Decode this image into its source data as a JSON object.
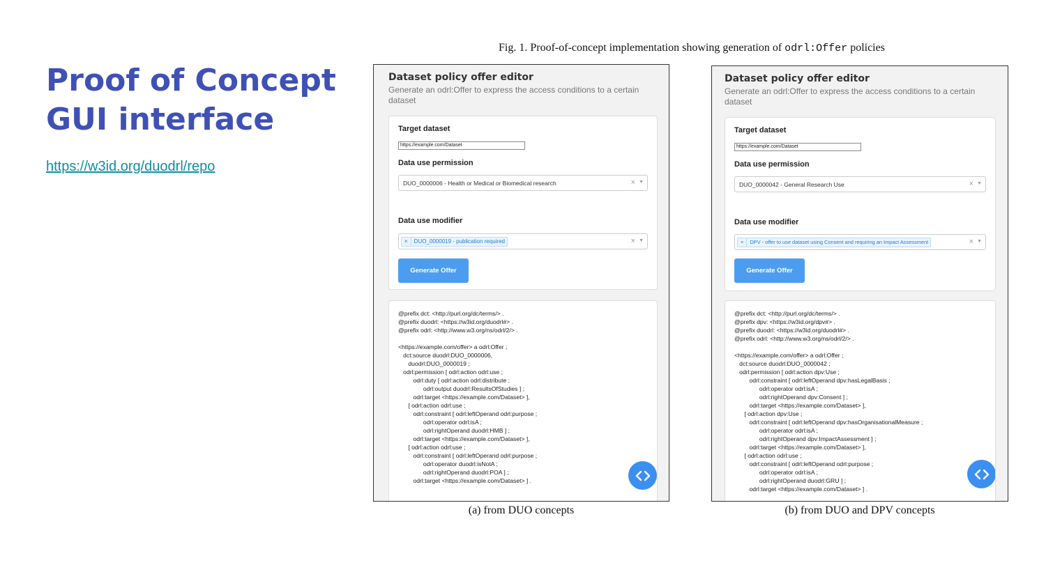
{
  "slide": {
    "title_line1": "Proof of Concept",
    "title_line2": "GUI interface",
    "repo_link": "https://w3id.org/duodrl/repo"
  },
  "figure": {
    "caption_prefix": "Fig. 1. Proof-of-concept implementation showing generation of ",
    "caption_code": "odrl:Offer",
    "caption_suffix": " policies",
    "subcaption_a": "(a)  from DUO concepts",
    "subcaption_b": "(b)  from DUO and DPV concepts"
  },
  "panels": {
    "a": {
      "editor_title": "Dataset policy offer editor",
      "editor_desc": "Generate an odrl:Offer to express the access conditions to a certain dataset",
      "target_label": "Target dataset",
      "target_value": "https://example.com/Dataset",
      "permission_label": "Data use permission",
      "permission_value": "DUO_0000006 - Health or Medical or Biomedical research",
      "modifier_label": "Data use modifier",
      "modifier_tag": "DUO_0000019 - publication required",
      "clear_symbol": "×",
      "tag_remove_symbol": "×",
      "generate_label": "Generate Offer",
      "code_lines": [
        "@prefix dct: <http://purl.org/dc/terms/> .",
        "@prefix duodrl: <https://w3id.org/duodrl#> .",
        "@prefix odrl: <http://www.w3.org/ns/odrl/2/> .",
        "",
        "<https://example.com/offer> a odrl:Offer ;",
        "   dct:source duodrl:DUO_0000006,",
        "      duodrl:DUO_0000019 ;",
        "   odrl:permission [ odrl:action odrl:use ;",
        "         odrl:duty [ odrl:action odrl:distribute ;",
        "               odrl:output duodrl:ResultsOfStudies ] ;",
        "         odrl:target <https://example.com/Dataset> ],",
        "      [ odrl:action odrl:use ;",
        "         odrl:constraint [ odrl:leftOperand odrl:purpose ;",
        "               odrl:operator odrl:isA ;",
        "               odrl:rightOperand duodrl:HMB ] ;",
        "         odrl:target <https://example.com/Dataset> ],",
        "      [ odrl:action odrl:use ;",
        "         odrl:constraint [ odrl:leftOperand odrl:purpose ;",
        "               odrl:operator duodrl:isNotA ;",
        "               odrl:rightOperand duodrl:POA ] ;",
        "         odrl:target <https://example.com/Dataset> ] ."
      ]
    },
    "b": {
      "editor_title": "Dataset policy offer editor",
      "editor_desc": "Generate an odrl:Offer to express the access conditions to a certain dataset",
      "target_label": "Target dataset",
      "target_value": "https://example.com/Dataset",
      "permission_label": "Data use permission",
      "permission_value": "DUO_0000042 - General Research Use",
      "modifier_label": "Data use modifier",
      "modifier_tag": "DPV - offer to use dataset using Consent and requiring an Impact Assessment",
      "clear_symbol": "×",
      "tag_remove_symbol": "×",
      "generate_label": "Generate Offer",
      "code_lines": [
        "@prefix dct: <http://purl.org/dc/terms/> .",
        "@prefix dpv: <https://w3id.org/dpv#> .",
        "@prefix duodrl: <https://w3id.org/duodrl#> .",
        "@prefix odrl: <http://www.w3.org/ns/odrl/2/> .",
        "",
        "<https://example.com/offer> a odrl:Offer ;",
        "   dct:source duodrl:DUO_0000042 ;",
        "   odrl:permission [ odrl:action dpv:Use ;",
        "         odrl:constraint [ odrl:leftOperand dpv:hasLegalBasis ;",
        "               odrl:operator odrl:isA ;",
        "               odrl:rightOperand dpv:Consent ] ;",
        "         odrl:target <https://example.com/Dataset> ],",
        "      [ odrl:action dpv:Use ;",
        "         odrl:constraint [ odrl:leftOperand dpv:hasOrganisationalMeasure ;",
        "               odrl:operator odrl:isA ;",
        "               odrl:rightOperand dpv:ImpactAssessment ] ;",
        "         odrl:target <https://example.com/Dataset> ],",
        "      [ odrl:action odrl:use ;",
        "         odrl:constraint [ odrl:leftOperand odrl:purpose ;",
        "               odrl:operator odrl:isA ;",
        "               odrl:rightOperand duodrl:GRU ] ;",
        "         odrl:target <https://example.com/Dataset> ] ."
      ]
    }
  },
  "colors": {
    "title": "#3f51b5",
    "link": "#0b8ea8",
    "button": "#4c9df0",
    "fab": "#3b8ff0",
    "tag_text": "#1e7cd3"
  },
  "icons": {
    "fab": "code-brackets-icon",
    "dropdown": "chevron-down-icon",
    "clear": "close-icon"
  }
}
